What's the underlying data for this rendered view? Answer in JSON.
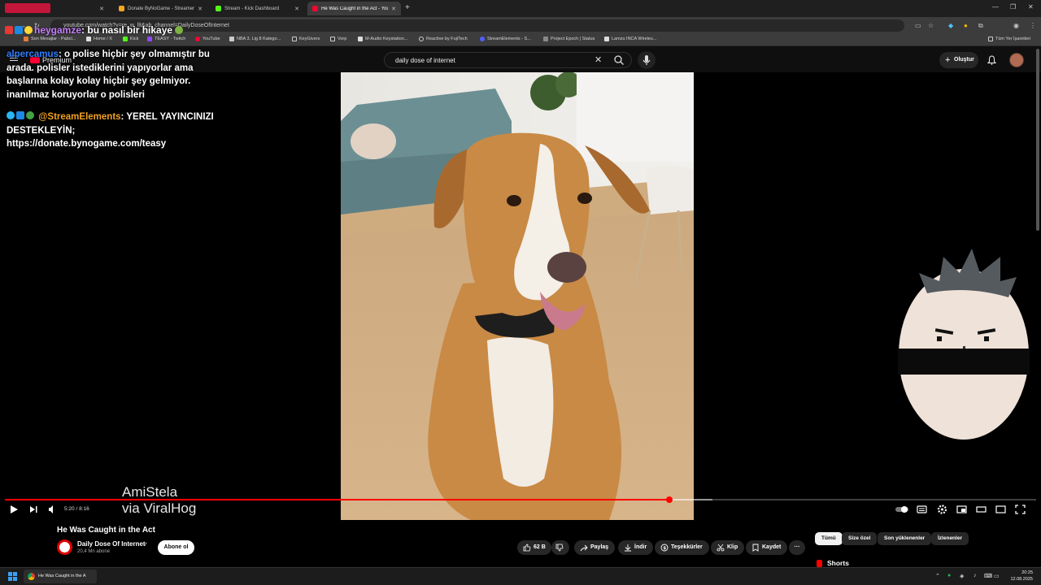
{
  "browser": {
    "tabs": [
      {
        "label": "",
        "favicon_color": "#e91e63"
      },
      {
        "label": "Donate ByNoGame - Streamer",
        "favicon_color": "#f5a623"
      },
      {
        "label": "Stream - Kick Dashboard",
        "favicon_color": "#53fc18"
      },
      {
        "label": "He Was Caught in the Act - YouTube",
        "favicon_color": "#ff0033"
      }
    ],
    "url": "youtube.com/watch?v=re_w_llt&ab_channel=DailyDoseOfInternet",
    "bookmarks": [
      "Son Mesajlar - Pabcl...",
      "Home / X",
      "Kick",
      "TEASY - Twitch",
      "YouTube",
      "NBA 3. Lig 8 Katego...",
      "KeyGivers",
      "Vorp",
      "M-Audio Keystation...",
      "Reactive by FujiTech",
      "StreamElements - S...",
      "Project Epoch | Status",
      "Lamzu INCA Wireles..."
    ],
    "all_bookmarks": "Tüm Yer İşaretleri"
  },
  "youtube": {
    "logo_text": "Premium",
    "search_value": "daily dose of internet",
    "create_label": "Oluştur"
  },
  "chat": {
    "top": {
      "user": "heygamze",
      "text": ": bu nasıl bir hikaye"
    },
    "messages": [
      {
        "user": "alpercamus",
        "text": ": o polise hiçbir şey olmamıştır bu arada. polisler istediklerini yapıyorlar ama başlarına kolay kolay hiçbir şey gelmiyor. inanılmaz koruyorlar o polisleri"
      },
      {
        "user": "@StreamElements",
        "text": ": YEREL YAYINCINIZI DESTEKLEYİN; https://donate.bynogame.com/teasy"
      }
    ]
  },
  "video": {
    "watermark_line1": "AmiStela",
    "watermark_line2": "via ViralHog",
    "time": "5:20 / 8:16",
    "progress_fraction": 0.644,
    "buffer_fraction": 0.686,
    "title": "He Was Caught in the Act",
    "channel": "Daily Dose Of Internet",
    "subscribers": "20,4 Mn abone",
    "subscribe_label": "Abone ol"
  },
  "actions": {
    "like_count": "62 B",
    "share": "Paylaş",
    "download": "İndir",
    "thanks": "Teşekkürler",
    "clip": "Klip",
    "save": "Kaydet",
    "more": "···"
  },
  "chips": [
    "Tümü",
    "Size özel",
    "Son yüklenenler",
    "İzlenenler"
  ],
  "shorts_label": "Shorts",
  "taskbar": {
    "window_label": "He Was Caught in the A",
    "time": "20:25",
    "date": "12.08.2025"
  }
}
